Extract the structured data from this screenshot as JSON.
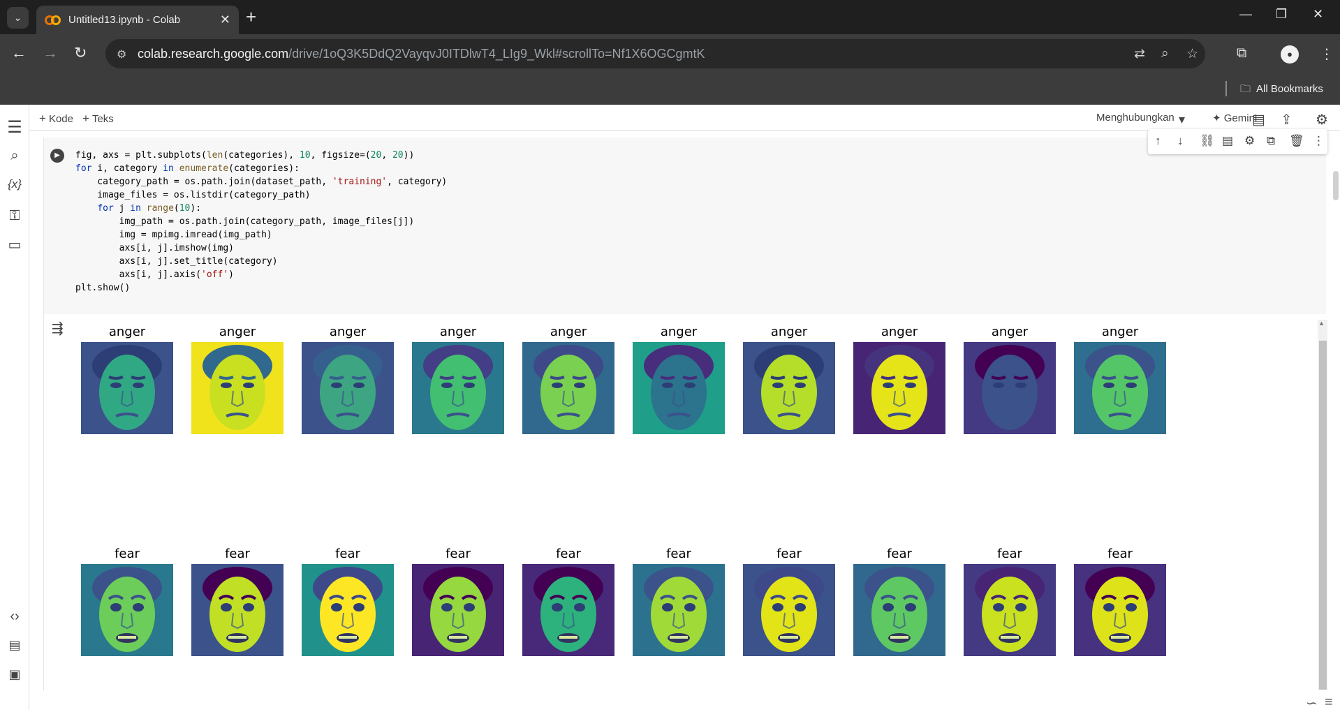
{
  "browser": {
    "tab_title": "Untitled13.ipynb - Colab",
    "tab_close": "✕",
    "new_tab": "+",
    "url_host": "colab.research.google.com",
    "url_path": "/drive/1oQ3K5DdQ2VayqvJ0ITDlwT4_LIg9_Wkl#scrollTo=Nf1X6OGCgmtK",
    "all_bookmarks": "All Bookmarks"
  },
  "colab": {
    "add_code": "Kode",
    "add_text": "Teks",
    "connect": "Menghubungkan",
    "gemini": "Gemini"
  },
  "code_lines": [
    "fig, axs = plt.subplots(len(categories), 10, figsize=(20, 20))",
    "for i, category in enumerate(categories):",
    "    category_path = os.path.join(dataset_path, 'training', category)",
    "    image_files = os.listdir(category_path)",
    "    for j in range(10):",
    "        img_path = os.path.join(category_path, image_files[j])",
    "        img = mpimg.imread(img_path)",
    "        axs[i, j].imshow(img)",
    "        axs[i, j].set_title(category)",
    "        axs[i, j].axis('off')",
    "plt.show()"
  ],
  "output": {
    "rows": [
      {
        "label": "anger",
        "faces": [
          {
            "title": "anger",
            "bg": "#3b528b",
            "face": "#31a884",
            "hair": "#2c3e75"
          },
          {
            "title": "anger",
            "bg": "#f0e31c",
            "face": "#c8e020",
            "hair": "#31688e"
          },
          {
            "title": "anger",
            "bg": "#3b528b",
            "face": "#3da581",
            "hair": "#355f8d"
          },
          {
            "title": "anger",
            "bg": "#2a788e",
            "face": "#43bf71",
            "hair": "#433e85"
          },
          {
            "title": "anger",
            "bg": "#31688e",
            "face": "#7ad151",
            "hair": "#3e4989"
          },
          {
            "title": "anger",
            "bg": "#1f9e89",
            "face": "#2c738e",
            "hair": "#472d7b"
          },
          {
            "title": "anger",
            "bg": "#3b528b",
            "face": "#b5de2b",
            "hair": "#2c3e75"
          },
          {
            "title": "anger",
            "bg": "#482475",
            "face": "#e5e419",
            "hair": "#46337e"
          },
          {
            "title": "anger",
            "bg": "#443983",
            "face": "#3b528b",
            "hair": "#440154"
          },
          {
            "title": "anger",
            "bg": "#2e6e8e",
            "face": "#55c667",
            "hair": "#3b528b"
          }
        ]
      },
      {
        "label": "fear",
        "faces": [
          {
            "title": "fear",
            "bg": "#2a788e",
            "face": "#6ccd5a",
            "hair": "#3b528b"
          },
          {
            "title": "fear",
            "bg": "#3b528b",
            "face": "#c0df25",
            "hair": "#440154"
          },
          {
            "title": "fear",
            "bg": "#21918c",
            "face": "#fde725",
            "hair": "#3e4989"
          },
          {
            "title": "fear",
            "bg": "#482475",
            "face": "#95d840",
            "hair": "#440154"
          },
          {
            "title": "fear",
            "bg": "#482878",
            "face": "#2db27d",
            "hair": "#440154"
          },
          {
            "title": "fear",
            "bg": "#2c728e",
            "face": "#a0da39",
            "hair": "#3b528b"
          },
          {
            "title": "fear",
            "bg": "#3b528b",
            "face": "#e2e418",
            "hair": "#3e4989"
          },
          {
            "title": "fear",
            "bg": "#31688e",
            "face": "#5ec962",
            "hair": "#3b528b"
          },
          {
            "title": "fear",
            "bg": "#443983",
            "face": "#cae11f",
            "hair": "#482475"
          },
          {
            "title": "fear",
            "bg": "#46327e",
            "face": "#dde318",
            "hair": "#440154"
          }
        ]
      }
    ]
  },
  "colors": {
    "chrome_dark": "#1f1f1f",
    "chrome_mid": "#3c3c3c",
    "cell_bg": "#f7f7f7"
  }
}
